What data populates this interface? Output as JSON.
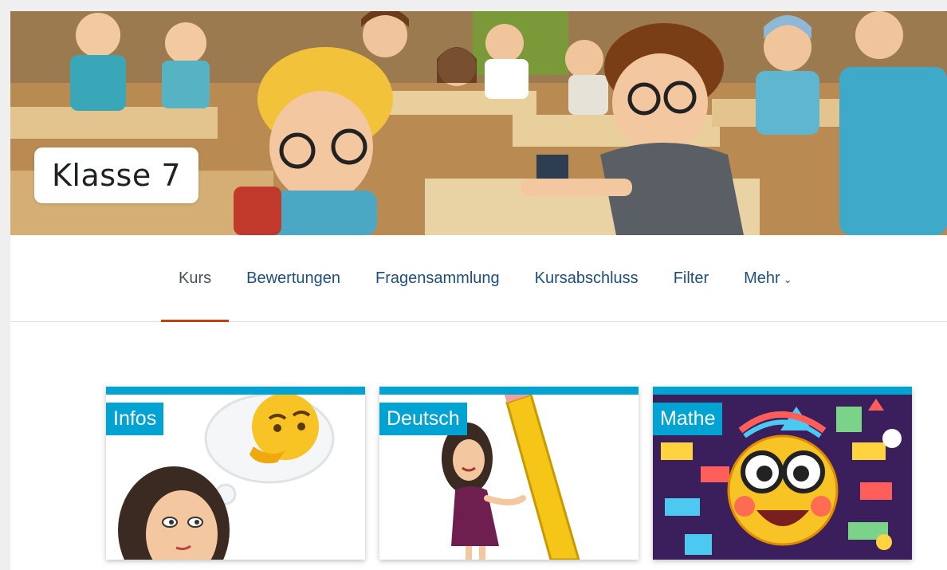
{
  "course": {
    "title": "Klasse 7"
  },
  "nav": {
    "tabs": [
      {
        "label": "Kurs",
        "active": true
      },
      {
        "label": "Bewertungen"
      },
      {
        "label": "Fragensammlung"
      },
      {
        "label": "Kursabschluss"
      },
      {
        "label": "Filter"
      },
      {
        "label": "Mehr",
        "chevron": "chevron-down-icon"
      }
    ]
  },
  "cards": [
    {
      "label": "Infos",
      "image": "thinking-teacher-illustration"
    },
    {
      "label": "Deutsch",
      "image": "teacher-with-pencil-illustration"
    },
    {
      "label": "Mathe",
      "image": "math-emoji-collage"
    }
  ],
  "colors": {
    "accent": "#00a3d1",
    "active_tab_underline": "#c2410c",
    "link": "#1f4e79"
  }
}
